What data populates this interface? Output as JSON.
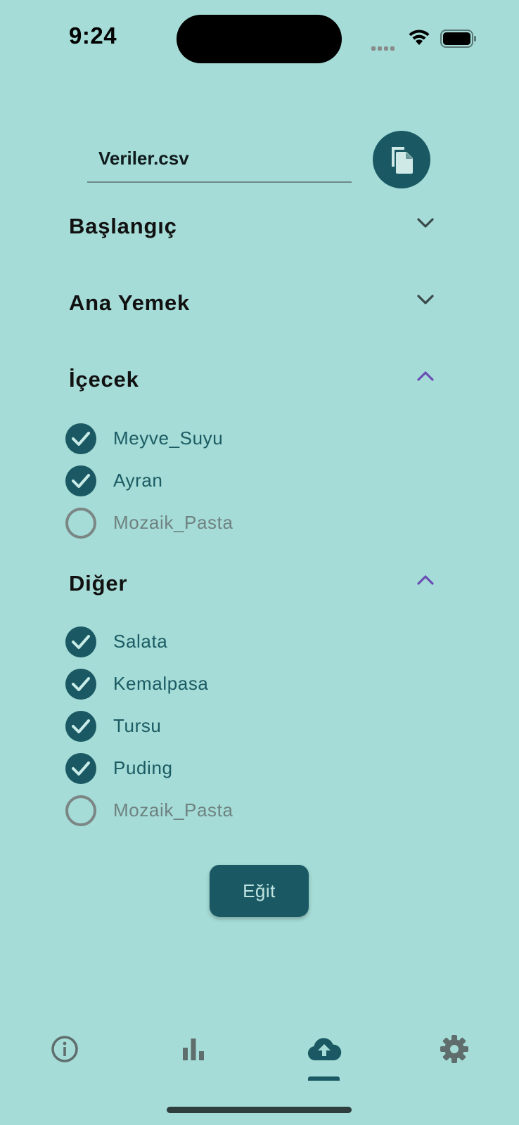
{
  "status_bar": {
    "time": "9:24"
  },
  "file": {
    "name": "Veriler.csv"
  },
  "sections": [
    {
      "title": "Başlangıç",
      "expanded": false,
      "items": []
    },
    {
      "title": "Ana Yemek",
      "expanded": false,
      "items": []
    },
    {
      "title": "İçecek",
      "expanded": true,
      "items": [
        {
          "label": "Meyve_Suyu",
          "checked": true
        },
        {
          "label": "Ayran",
          "checked": true
        },
        {
          "label": "Mozaik_Pasta",
          "checked": false
        }
      ]
    },
    {
      "title": "Diğer",
      "expanded": true,
      "items": [
        {
          "label": "Salata",
          "checked": true
        },
        {
          "label": "Kemalpasa",
          "checked": true
        },
        {
          "label": "Tursu",
          "checked": true
        },
        {
          "label": "Puding",
          "checked": true
        },
        {
          "label": "Mozaik_Pasta",
          "checked": false
        }
      ]
    }
  ],
  "train_button": {
    "label": "Eğit"
  },
  "bottom_nav": {
    "items": [
      {
        "icon": "info-icon"
      },
      {
        "icon": "bar-chart-icon"
      },
      {
        "icon": "cloud-upload-icon",
        "selected": true
      },
      {
        "icon": "gear-icon"
      }
    ]
  },
  "colors": {
    "background": "#a5dcd7",
    "accent": "#1a5963",
    "chevron_expanded": "#6b4fb5",
    "chevron_collapsed": "#3a4a49"
  }
}
